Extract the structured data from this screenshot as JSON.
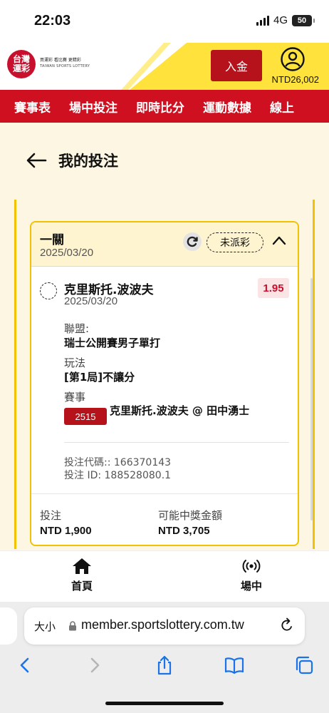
{
  "status_bar": {
    "time": "22:03",
    "network": "4G",
    "battery": "50"
  },
  "header": {
    "logo_text_1": "台灣",
    "logo_text_2": "運彩",
    "logo_tagline": "買運彩 看比賽 更精彩",
    "logo_english": "TAIWAN SPORTS LOTTERY",
    "deposit_label": "入金",
    "balance": "NTD26,002"
  },
  "nav": {
    "items": [
      "賽事表",
      "場中投注",
      "即時比分",
      "運動數據",
      "線上"
    ]
  },
  "page": {
    "back_icon": "back-arrow-icon",
    "title": "我的投注"
  },
  "bet": {
    "type": "一關",
    "date": "2025/03/20",
    "status": "未派彩",
    "selection": {
      "name": "克里斯托.波波夫",
      "date": "2025/03/20",
      "odds": "1.95",
      "league_label": "聯盟:",
      "league": "瑞士公開賽男子單打",
      "market_label": "玩法",
      "market": "[第1局]不讓分",
      "event_label": "賽事",
      "event_code": "2515",
      "event_name": "克里斯托.波波夫 @ 田中湧士"
    },
    "bet_code_label": "投注代碼:: 166370143",
    "bet_id_label": "投注 ID: 188528080.1",
    "stake_label": "投注",
    "stake": "NTD 1,900",
    "payout_label": "可能中獎金額",
    "payout": "NTD 3,705"
  },
  "tabbar": {
    "home": "首頁",
    "live": "場中"
  },
  "browser": {
    "aa": "大小",
    "url": "member.sportslottery.com.tw"
  },
  "colors": {
    "red": "#cf1020",
    "yellow": "#ffe33c",
    "cream": "#fdf6e3"
  }
}
